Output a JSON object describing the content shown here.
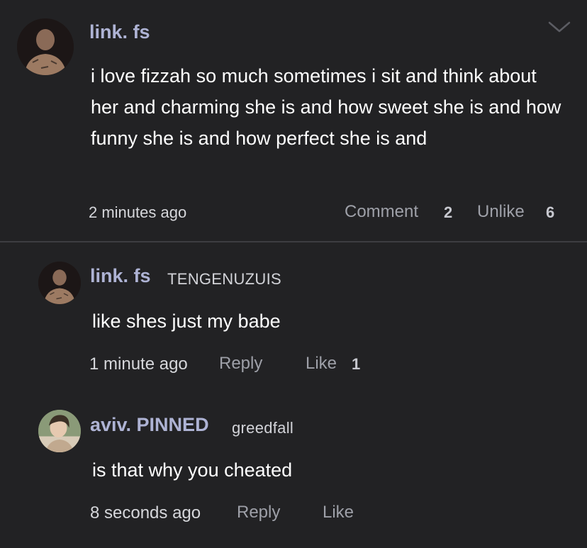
{
  "main_comment": {
    "username": "link. fs",
    "text": "i love fizzah so much sometimes i sit and think about her and charming she is and how sweet she is and how funny she is and how perfect she is and",
    "time": "2 minutes ago",
    "comment_label": "Comment",
    "comment_count": "2",
    "unlike_label": "Unlike",
    "like_count": "6",
    "avatar_icon": "profile-photo"
  },
  "replies": [
    {
      "username": "link. fs",
      "tag": "TENGENUZUIS",
      "text": "like shes just my babe",
      "time": "1 minute ago",
      "reply_label": "Reply",
      "like_label": "Like",
      "like_count": "1"
    },
    {
      "username": "aviv. PINNED",
      "tag": "greedfall",
      "text": "is that why you cheated",
      "time": "8 seconds ago",
      "reply_label": "Reply",
      "like_label": "Like",
      "like_count": ""
    }
  ],
  "colors": {
    "background": "#222224",
    "username": "#aeb3d4",
    "divider": "#3d3d41"
  }
}
